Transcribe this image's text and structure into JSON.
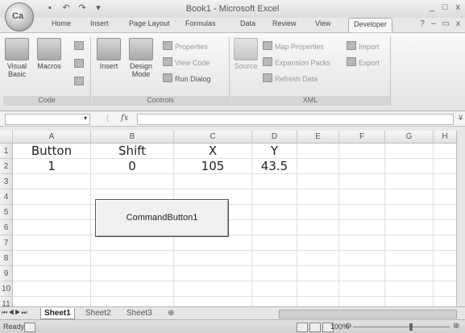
{
  "window": {
    "title": "Book1 - Microsoft Excel",
    "minimize": "_",
    "maximize": "□",
    "close": "x",
    "office_button_label": "Ca"
  },
  "tabs": [
    "Home",
    "Insert",
    "Page Layout",
    "Formulas",
    "Data",
    "Review",
    "View",
    "Developer"
  ],
  "ribbon": {
    "code_group": {
      "label": "Code",
      "visual_basic": "Visual Basic",
      "macros": "Macros"
    },
    "controls_group": {
      "label": "Controls",
      "insert": "Insert",
      "design_mode": "Design Mode",
      "properties": "Properties",
      "view_code": "View Code",
      "run_dialog": "Run Dialog"
    },
    "xml_group": {
      "label": "XML",
      "source": "Source",
      "map_properties": "Map Properties",
      "expansion_packs": "Expansion Packs",
      "refresh_data": "Refresh Data",
      "import": "Import",
      "export": "Export"
    }
  },
  "formula_bar": {
    "fx": "fx",
    "namebox_value": ""
  },
  "columns": [
    "A",
    "B",
    "C",
    "D",
    "E",
    "F",
    "G",
    "H"
  ],
  "rows": [
    "1",
    "2",
    "3",
    "4",
    "5",
    "6",
    "7",
    "8",
    "9",
    "10",
    "11"
  ],
  "cells": {
    "A1": "Button",
    "B1": "Shift",
    "C1": "X",
    "D1": "Y",
    "A2": "1",
    "B2": "0",
    "C2": "105",
    "D2": "43.5"
  },
  "command_button": {
    "caption": "CommandButton1"
  },
  "sheets": [
    "Sheet1",
    "Sheet2",
    "Sheet3"
  ],
  "status": {
    "ready": "Ready",
    "zoom": "100%"
  }
}
